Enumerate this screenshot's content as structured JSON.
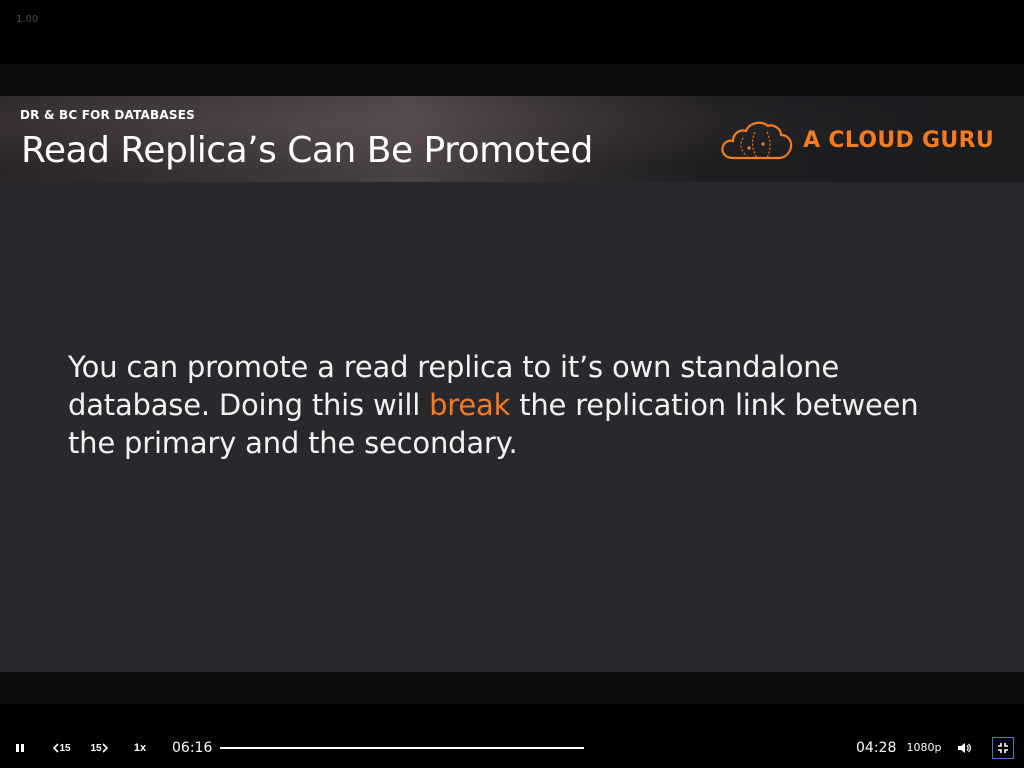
{
  "overlay": {
    "zoom_text": "1.00"
  },
  "slide": {
    "course_label": "DR & BC FOR DATABASES",
    "title": "Read Replica’s Can Be Promoted",
    "brand": "A CLOUD GURU",
    "body_before": "You can promote a read replica to it’s own standalone database. Doing this will ",
    "body_highlight": "break",
    "body_after": " the replication link between the primary and the secondary.",
    "accent_color": "#f47b20"
  },
  "player": {
    "play_state_icon": "pause-icon",
    "rewind_label": "15",
    "forward_label": "15",
    "speed_label": "1x",
    "elapsed_time": "06:16",
    "remaining_time": "04:28",
    "quality_label": "1080p",
    "volume_icon": "volume-icon",
    "fullscreen_icon": "exit-fullscreen-icon"
  }
}
